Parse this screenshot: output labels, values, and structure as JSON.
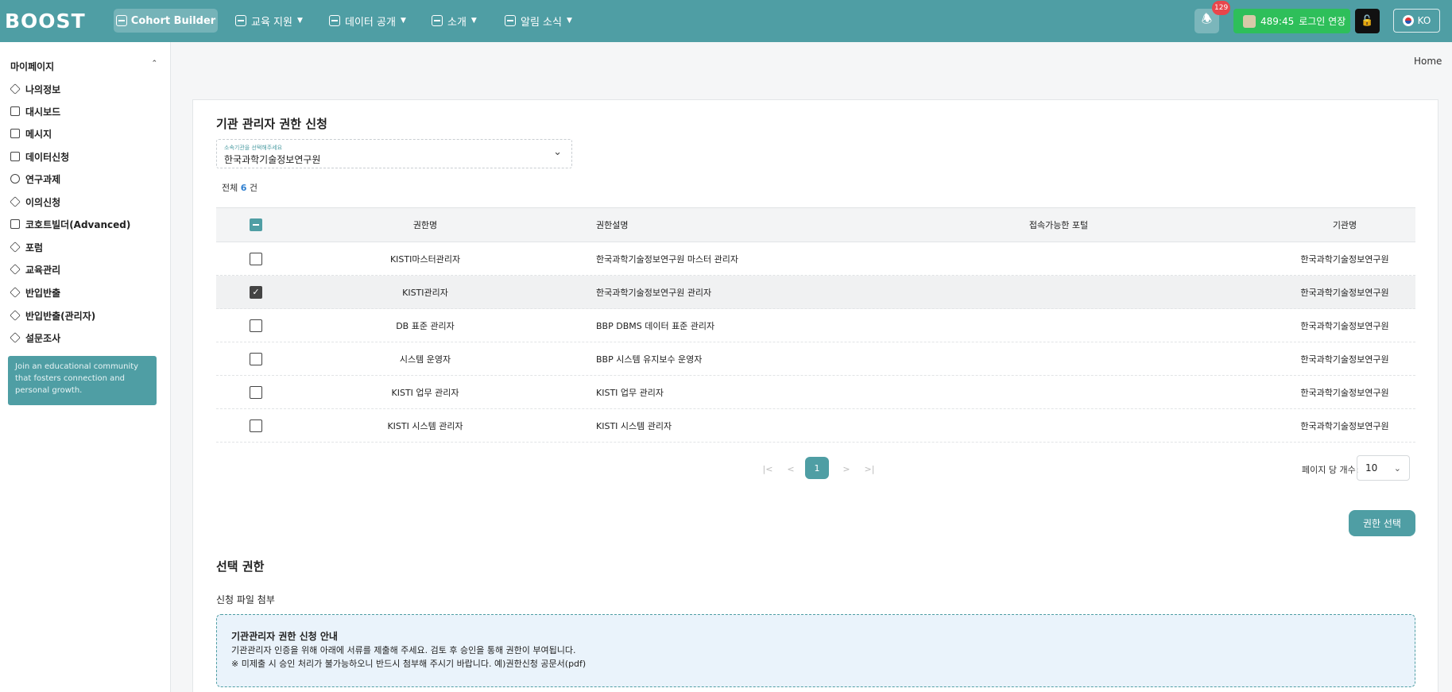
{
  "header": {
    "logo_text": "BOOST",
    "cohort_label": "Cohort Builder",
    "nav": [
      {
        "label": "교육 지원"
      },
      {
        "label": "데이터 공개"
      },
      {
        "label": "소개"
      },
      {
        "label": "알림 소식"
      }
    ],
    "notification_count": "129",
    "session_time": "489:45",
    "session_extend_label": "로그인 연장",
    "language": "KO"
  },
  "sidebar": {
    "title": "마이페이지",
    "items": [
      {
        "label": "나의정보"
      },
      {
        "label": "대시보드"
      },
      {
        "label": "메시지"
      },
      {
        "label": "데이터신청"
      },
      {
        "label": "연구과제"
      },
      {
        "label": "이의신청"
      },
      {
        "label": "코호트빌더(Advanced)"
      },
      {
        "label": "포럼"
      },
      {
        "label": "교육관리"
      },
      {
        "label": "반입반출"
      },
      {
        "label": "반입반출(관리자)"
      },
      {
        "label": "설문조사"
      }
    ],
    "promo_text": "Join an educational community that fosters connection and personal growth."
  },
  "breadcrumb": "Home",
  "main": {
    "title": "기관 관리자 권한 신청",
    "org_select": {
      "label": "소속기관을 선택해주세요",
      "value": "한국과학기술정보연구원"
    },
    "count_prefix": "전체",
    "count_value": "6",
    "count_suffix": "건",
    "table": {
      "columns": [
        "권한명",
        "권한설명",
        "접속가능한 포털",
        "기관명"
      ],
      "rows": [
        {
          "name": "KISTI마스터관리자",
          "desc": "한국과학기술정보연구원 마스터 관리자",
          "portal": "",
          "org": "한국과학기술정보연구원",
          "checked": false
        },
        {
          "name": "KISTI관리자",
          "desc": "한국과학기술정보연구원 관리자",
          "portal": "",
          "org": "한국과학기술정보연구원",
          "checked": true
        },
        {
          "name": "DB 표준 관리자",
          "desc": "BBP DBMS 데이터 표준 관리자",
          "portal": "",
          "org": "한국과학기술정보연구원",
          "checked": false
        },
        {
          "name": "시스템 운영자",
          "desc": "BBP 시스템 유지보수 운영자",
          "portal": "",
          "org": "한국과학기술정보연구원",
          "checked": false
        },
        {
          "name": "KISTI 업무 관리자",
          "desc": "KISTI 업무 관리자",
          "portal": "",
          "org": "한국과학기술정보연구원",
          "checked": false
        },
        {
          "name": "KISTI 시스템 관리자",
          "desc": "KISTI 시스템 관리자",
          "portal": "",
          "org": "한국과학기술정보연구원",
          "checked": false
        }
      ]
    },
    "pagination": {
      "current_page": "1",
      "per_page_label": "페이지 당 개수:",
      "per_page_value": "10"
    },
    "select_button": "권한 선택",
    "selected_section_title": "선택 권한",
    "attach_label": "신청 파일 첨부",
    "notice": {
      "title": "기관관리자 권한 신청 안내",
      "line1": "기관관리자 인증을 위해 아래에 서류를 제출해 주세요. 검토 후 승인을 통해 권한이 부여됩니다.",
      "line2": "※ 미제출 시 승인 처리가 불가능하오니 반드시 첨부해 주시기 바랍니다. 예)권한신청 공문서(pdf)"
    }
  }
}
